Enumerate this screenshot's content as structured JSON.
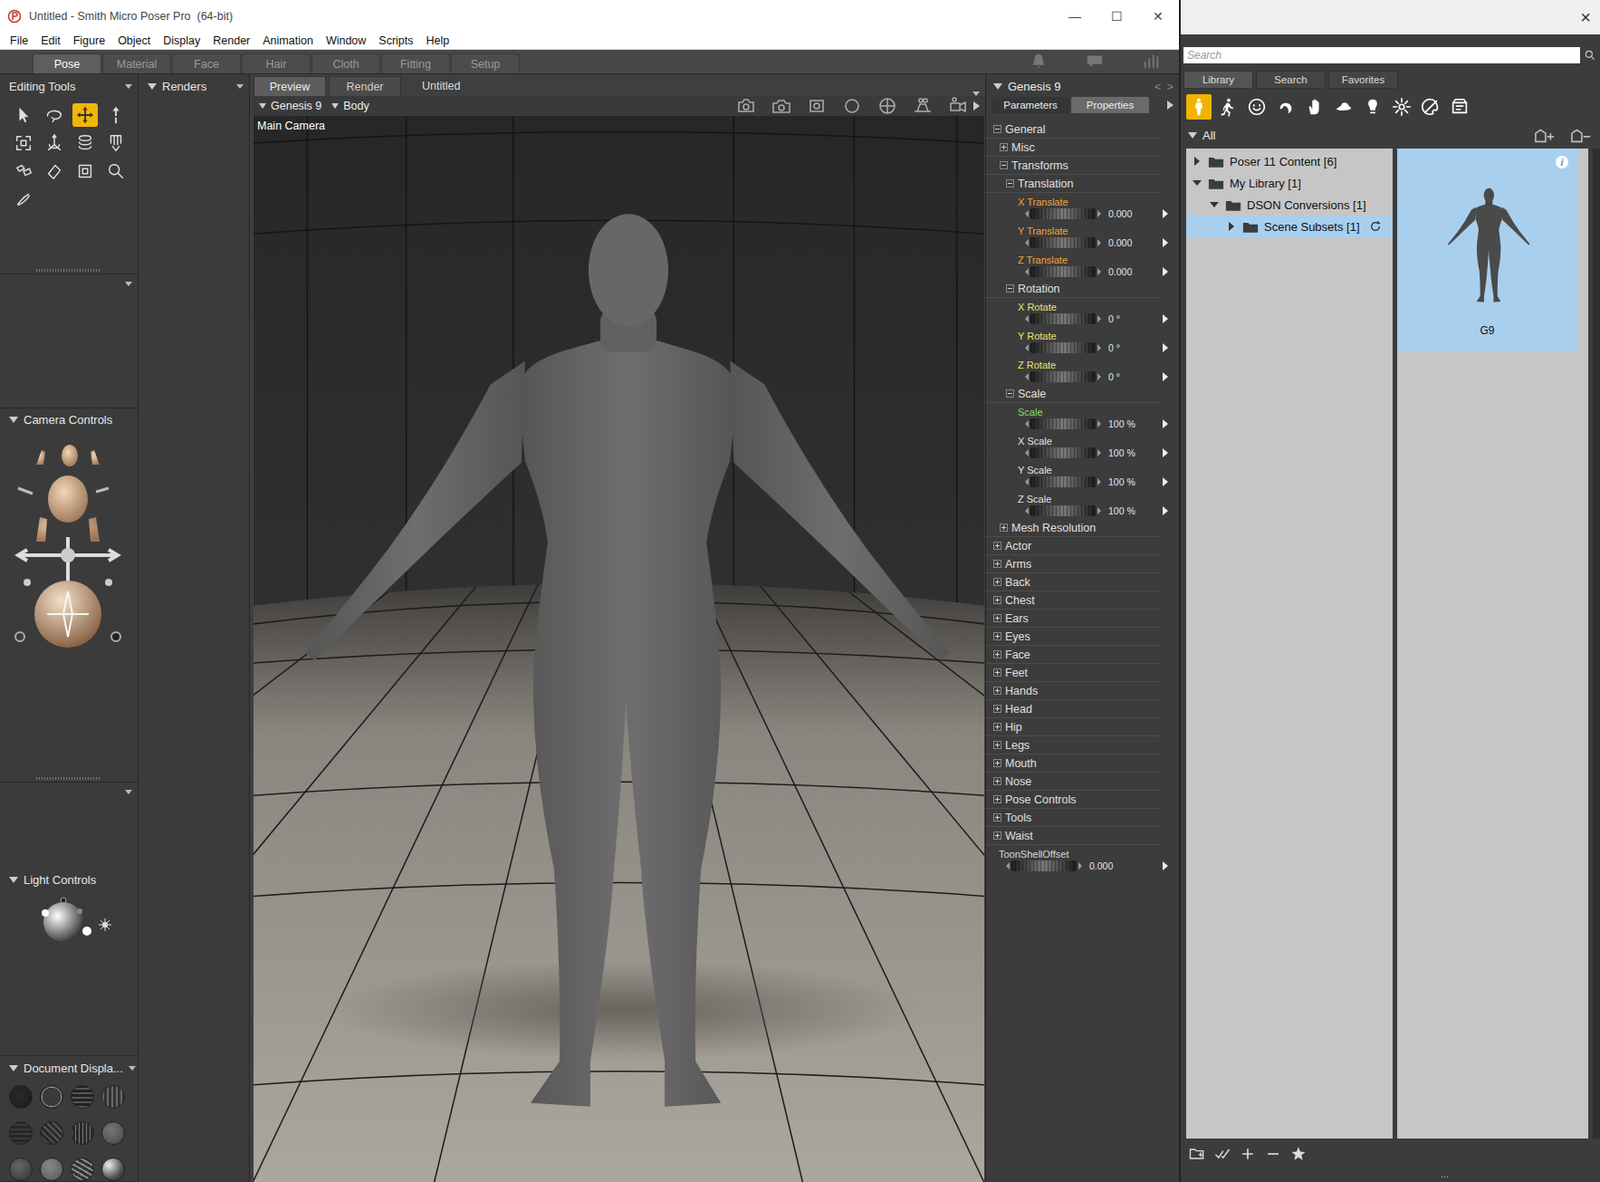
{
  "window": {
    "title": "Untitled - Smith Micro Poser Pro  (64-bit)",
    "controls": [
      "—",
      "☐",
      "✕"
    ]
  },
  "menu": [
    "File",
    "Edit",
    "Figure",
    "Object",
    "Display",
    "Render",
    "Animation",
    "Window",
    "Scripts",
    "Help"
  ],
  "rooms": [
    {
      "label": "Pose",
      "selected": true
    },
    {
      "label": "Material",
      "selected": false
    },
    {
      "label": "Face",
      "selected": false
    },
    {
      "label": "Hair",
      "selected": false
    },
    {
      "label": "Cloth",
      "selected": false
    },
    {
      "label": "Fitting",
      "selected": false
    },
    {
      "label": "Setup",
      "selected": false
    }
  ],
  "editing_tools": {
    "title": "Editing Tools",
    "tools": [
      {
        "selected": false
      },
      {
        "selected": false
      },
      {
        "selected": true
      },
      {
        "selected": false
      },
      {
        "selected": false
      },
      {
        "selected": false
      },
      {
        "selected": false
      },
      {
        "selected": false
      },
      {
        "selected": false
      },
      {
        "selected": false
      },
      {
        "selected": false
      },
      {
        "selected": false
      },
      {
        "selected": false
      }
    ]
  },
  "panels": {
    "camera_controls": "Camera Controls",
    "light_controls": "Light Controls",
    "document_display": "Document Displa...",
    "renders": "Renders"
  },
  "viewport": {
    "tabs": [
      {
        "label": "Preview",
        "selected": true
      },
      {
        "label": "Render",
        "selected": false
      }
    ],
    "document": "Untitled",
    "figure": "Genesis 9",
    "actor": "Body",
    "camera": "Main Camera"
  },
  "parameters": {
    "figure": "Genesis 9",
    "nav": [
      "<",
      ">"
    ],
    "tabs": [
      {
        "label": "Parameters",
        "selected": true
      },
      {
        "label": "Properties",
        "selected": false
      }
    ],
    "rows": [
      {
        "kind": "group",
        "label": "General",
        "expanded": true,
        "children": [
          {
            "kind": "group",
            "label": "Misc",
            "expanded": false
          },
          {
            "kind": "group",
            "label": "Transforms",
            "expanded": true,
            "children": [
              {
                "kind": "group",
                "label": "Translation",
                "expanded": true,
                "children": [
                  {
                    "kind": "dial",
                    "label": "X Translate",
                    "value": "0.000",
                    "color": "#f2a33a"
                  },
                  {
                    "kind": "dial",
                    "label": "Y Translate",
                    "value": "0.000",
                    "color": "#f2a33a"
                  },
                  {
                    "kind": "dial",
                    "label": "Z Translate",
                    "value": "0.000",
                    "color": "#f2a33a"
                  }
                ]
              },
              {
                "kind": "group",
                "label": "Rotation",
                "expanded": true,
                "children": [
                  {
                    "kind": "dial",
                    "label": "X Rotate",
                    "value": "0 °",
                    "color": "#f0e26a"
                  },
                  {
                    "kind": "dial",
                    "label": "Y Rotate",
                    "value": "0 °",
                    "color": "#f0e26a"
                  },
                  {
                    "kind": "dial",
                    "label": "Z Rotate",
                    "value": "0 °",
                    "color": "#f0e26a"
                  }
                ]
              },
              {
                "kind": "group",
                "label": "Scale",
                "expanded": true,
                "children": [
                  {
                    "kind": "dial",
                    "label": "Scale",
                    "value": "100 %",
                    "color": "#86dd6e"
                  },
                  {
                    "kind": "dial",
                    "label": "X Scale",
                    "value": "100 %",
                    "color": "#e4e4e4"
                  },
                  {
                    "kind": "dial",
                    "label": "Y Scale",
                    "value": "100 %",
                    "color": "#e4e4e4"
                  },
                  {
                    "kind": "dial",
                    "label": "Z Scale",
                    "value": "100 %",
                    "color": "#e4e4e4"
                  }
                ]
              }
            ]
          },
          {
            "kind": "group",
            "label": "Mesh Resolution",
            "expanded": false
          }
        ]
      },
      {
        "kind": "group",
        "label": "Actor",
        "expanded": false
      },
      {
        "kind": "group",
        "label": "Arms",
        "expanded": false
      },
      {
        "kind": "group",
        "label": "Back",
        "expanded": false
      },
      {
        "kind": "group",
        "label": "Chest",
        "expanded": false
      },
      {
        "kind": "group",
        "label": "Ears",
        "expanded": false
      },
      {
        "kind": "group",
        "label": "Eyes",
        "expanded": false
      },
      {
        "kind": "group",
        "label": "Face",
        "expanded": false
      },
      {
        "kind": "group",
        "label": "Feet",
        "expanded": false
      },
      {
        "kind": "group",
        "label": "Hands",
        "expanded": false
      },
      {
        "kind": "group",
        "label": "Head",
        "expanded": false
      },
      {
        "kind": "group",
        "label": "Hip",
        "expanded": false
      },
      {
        "kind": "group",
        "label": "Legs",
        "expanded": false
      },
      {
        "kind": "group",
        "label": "Mouth",
        "expanded": false
      },
      {
        "kind": "group",
        "label": "Nose",
        "expanded": false
      },
      {
        "kind": "group",
        "label": "Pose Controls",
        "expanded": false
      },
      {
        "kind": "group",
        "label": "Tools",
        "expanded": false
      },
      {
        "kind": "group",
        "label": "Waist",
        "expanded": false
      },
      {
        "kind": "dial",
        "label": "ToonShellOffset",
        "value": "0.000",
        "color": "#d8d8d8"
      }
    ]
  },
  "library": {
    "close": "×",
    "search_placeholder": "Search",
    "tabs": [
      {
        "label": "Library",
        "selected": true
      },
      {
        "label": "Search",
        "selected": false
      },
      {
        "label": "Favorites",
        "selected": false
      }
    ],
    "categories": [
      {
        "selected": true
      },
      {
        "selected": false
      },
      {
        "selected": false
      },
      {
        "selected": false
      },
      {
        "selected": false
      },
      {
        "selected": false
      },
      {
        "selected": false
      },
      {
        "selected": false
      },
      {
        "selected": false
      },
      {
        "selected": false
      }
    ],
    "filter": "All",
    "tree": [
      {
        "label": "Poser 11 Content [6]",
        "expanded": false,
        "selected": false,
        "refresh": false
      },
      {
        "label": "My Library [1]",
        "expanded": true,
        "selected": false,
        "refresh": false,
        "children": [
          {
            "label": "DSON Conversions [1]",
            "expanded": true,
            "selected": false,
            "refresh": false,
            "children": [
              {
                "label": "Scene Subsets [1]",
                "expanded": false,
                "selected": true,
                "refresh": true
              }
            ]
          }
        ]
      }
    ],
    "items": [
      {
        "label": "G9",
        "selected": true,
        "info": "i"
      }
    ],
    "grip": "..."
  }
}
